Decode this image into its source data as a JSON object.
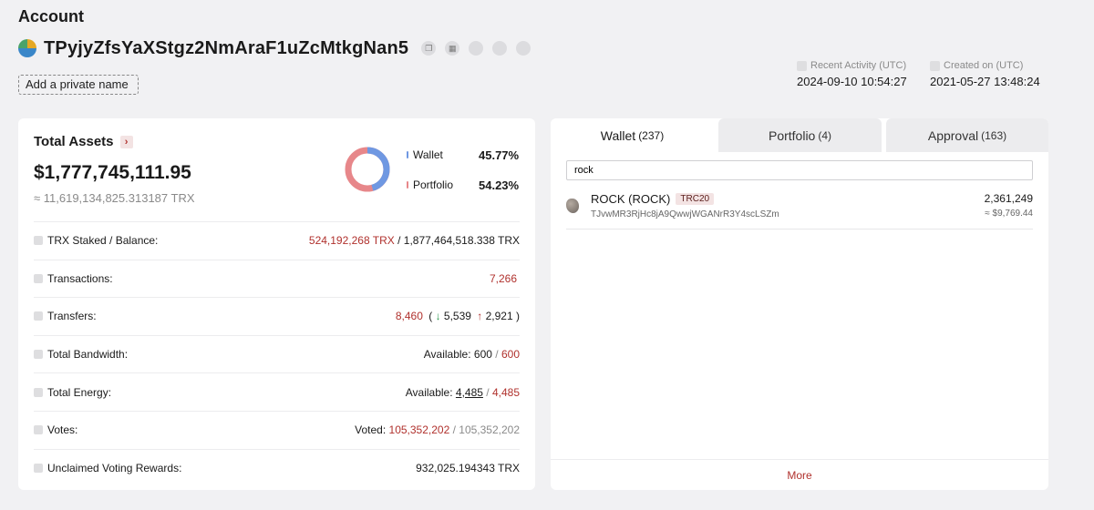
{
  "header": {
    "title": "Account",
    "address": "TPyjyZfsYaXStgz2NmAraF1uZcMtkgNan5",
    "private_name_label": "Add a private name",
    "recent_activity_label": "Recent Activity (UTC)",
    "recent_activity_value": "2024-09-10 10:54:27",
    "created_on_label": "Created on (UTC)",
    "created_on_value": "2021-05-27 13:48:24"
  },
  "assets": {
    "title": "Total Assets",
    "arrow": "›",
    "usd_value": "$1,777,745,111.95",
    "trx_value": "≈ 11,619,134,825.313187 TRX",
    "wallet_label": "Wallet",
    "wallet_pct": "45.77%",
    "wallet_fraction": 0.4577,
    "portfolio_label": "Portfolio",
    "portfolio_pct": "54.23%",
    "wallet_color": "#6f98e2",
    "portfolio_color": "#e7878a"
  },
  "stats": {
    "staked_label": "TRX Staked / Balance:",
    "staked_value": "524,192,268 TRX",
    "staked_sep": " / ",
    "balance_value": "1,877,464,518.338 TRX",
    "transactions_label": "Transactions:",
    "transactions_value": "7,266",
    "transfers_label": "Transfers:",
    "transfers_value": "8,460",
    "transfers_open": "(",
    "transfers_in_icon": "↓",
    "transfers_in": "5,539",
    "transfers_out_icon": "↑",
    "transfers_out": "2,921",
    "transfers_close": ")",
    "bandwidth_label": "Total Bandwidth:",
    "bandwidth_available_label": "Available:",
    "bandwidth_available": "600",
    "bandwidth_sep": " / ",
    "bandwidth_total": "600",
    "energy_label": "Total Energy:",
    "energy_available_label": "Available:",
    "energy_available": "4,485",
    "energy_sep": " / ",
    "energy_total": "4,485",
    "votes_label": "Votes:",
    "votes_voted_label": "Voted:",
    "votes_voted": "105,352,202",
    "votes_sep": " / ",
    "votes_total": "105,352,202",
    "rewards_label": "Unclaimed Voting Rewards:",
    "rewards_value": "932,025.194343 TRX"
  },
  "tabs": [
    {
      "label": "Wallet",
      "count": "(237)",
      "active": true
    },
    {
      "label": "Portfolio",
      "count": "(4)",
      "active": false
    },
    {
      "label": "Approval",
      "count": "(163)",
      "active": false
    }
  ],
  "wallet": {
    "search_value": "rock",
    "token": {
      "name": "ROCK (ROCK)",
      "standard": "TRC20",
      "contract": "TJvwMR3RjHc8jA9QwwjWGANrR3Y4scLSZm",
      "amount": "2,361,249",
      "usd": "≈ $9,769.44"
    },
    "more_label": "More"
  },
  "icons": {
    "copy": "copy-icon",
    "qr": "qr-code-icon",
    "logo": "tron-address-logo-icon"
  }
}
